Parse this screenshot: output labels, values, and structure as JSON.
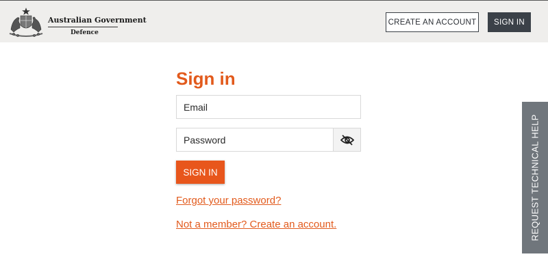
{
  "header": {
    "logo": {
      "line1": "Australian Government",
      "line2": "Defence"
    },
    "create_account_label": "CREATE AN ACCOUNT",
    "sign_in_label": "SIGN IN"
  },
  "form": {
    "title": "Sign in",
    "email_placeholder": "Email",
    "password_placeholder": "Password",
    "toggle_visibility_icon": "eye-slash-icon",
    "submit_label": "SIGN IN",
    "forgot_link": "Forgot your password?",
    "create_link": "Not a member? Create an account."
  },
  "side_tab": {
    "label": "REQUEST TECHNICAL HELP"
  },
  "colors": {
    "accent": "#e25a1c",
    "header_bg": "#efeeec",
    "dark_button": "#3b4148",
    "side_tab": "#70767c"
  }
}
